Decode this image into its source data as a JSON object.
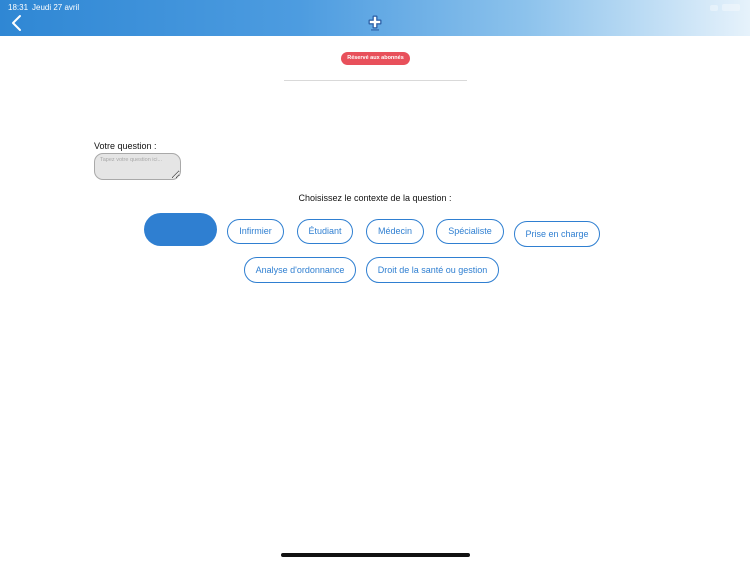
{
  "status_bar": {
    "time": "18:31",
    "date": "Jeudi 27 avril"
  },
  "header": {
    "back_icon": "chevron-left-icon",
    "logo_icon": "medical-cross-logo-icon",
    "gradient_start": "#2f87d4",
    "gradient_end": "#e6f2fb"
  },
  "badge": {
    "label": "Réservé aux abonnés",
    "color": "#e8505b"
  },
  "question": {
    "label": "Votre question :",
    "placeholder": "Tapez votre question ici...",
    "value": ""
  },
  "context": {
    "label": "Choisissez le contexte de la question :",
    "selected_index": 0,
    "options": [
      "",
      "Infirmier",
      "Étudiant",
      "Médecin",
      "Spécialiste",
      "Prise en charge",
      "Analyse d'ordonnance",
      "Droit de la santé ou gestion"
    ]
  },
  "colors": {
    "accent": "#2f7fd1",
    "badge": "#e8505b",
    "input_background": "#e5e5e5"
  }
}
